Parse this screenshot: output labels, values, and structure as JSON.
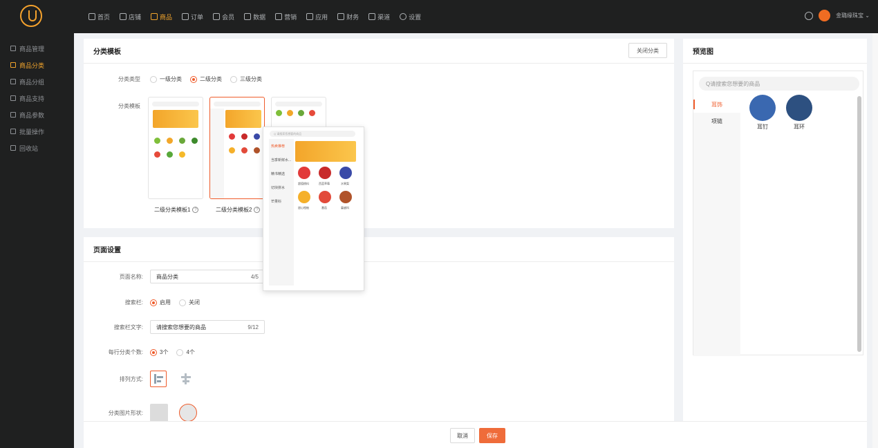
{
  "topbar": {
    "nav": [
      {
        "label": "首页",
        "icon": "home-icon",
        "active": false
      },
      {
        "label": "店铺",
        "icon": "store-icon",
        "active": false
      },
      {
        "label": "商品",
        "icon": "goods-icon",
        "active": true
      },
      {
        "label": "订单",
        "icon": "order-icon",
        "active": false
      },
      {
        "label": "会员",
        "icon": "member-icon",
        "active": false
      },
      {
        "label": "数据",
        "icon": "data-icon",
        "active": false
      },
      {
        "label": "营销",
        "icon": "marketing-icon",
        "active": false
      },
      {
        "label": "应用",
        "icon": "app-icon",
        "active": false
      },
      {
        "label": "财务",
        "icon": "finance-icon",
        "active": false
      },
      {
        "label": "渠道",
        "icon": "channel-icon",
        "active": false
      },
      {
        "label": "设置",
        "icon": "settings-icon",
        "active": false
      }
    ],
    "user_name": "金璐缘珠宝 ⌄"
  },
  "sidebar": {
    "items": [
      {
        "label": "商品管理",
        "active": false
      },
      {
        "label": "商品分类",
        "active": true
      },
      {
        "label": "商品分组",
        "active": false
      },
      {
        "label": "商品支持",
        "active": false
      },
      {
        "label": "商品参数",
        "active": false
      },
      {
        "label": "批量操作",
        "active": false
      },
      {
        "label": "回收站",
        "active": false
      }
    ]
  },
  "template_panel": {
    "title": "分类模板",
    "close_button": "关闭分类",
    "type_label": "分类类型",
    "type_options": [
      "一级分类",
      "二级分类",
      "三级分类"
    ],
    "type_selected": 1,
    "template_label": "分类模板",
    "templates": [
      "二级分类模板1",
      "二级分类模板2"
    ],
    "template_selected": 1
  },
  "page_panel": {
    "title": "页面设置",
    "name_label": "页面名称:",
    "name_value": "商品分类",
    "name_count": "4/5",
    "search_label": "搜索栏:",
    "search_options": [
      "启用",
      "关闭"
    ],
    "search_text_label": "搜索栏文字:",
    "search_text_value": "请搜索您想要的商品",
    "search_text_count": "9/12",
    "per_row_label": "每行分类个数:",
    "per_row_options": [
      "3个",
      "4个"
    ],
    "arrange_label": "排列方式:",
    "shape_label": "分类图片形状:"
  },
  "preview": {
    "title": "预览图",
    "search_placeholder": "Q请搜索您想要的商品",
    "categories": [
      "耳饰",
      "项链"
    ],
    "subcategories": [
      "耳钉",
      "耳环"
    ]
  },
  "popup": {
    "search": "Q 请搜索您想要的商品",
    "categories": [
      "热卖推荐",
      "当季新鲜水...",
      "精书精选",
      "切块拼水",
      "芒果科"
    ],
    "items": [
      "超值桃料",
      "西蓝草莓",
      "水果梨",
      "甜心橙柚",
      "番茄",
      "蔓越科"
    ]
  },
  "footer": {
    "cancel": "取消",
    "save": "保存"
  },
  "colors": {
    "accent": "#ef5b2a",
    "nav_active": "#f1a42c",
    "dark_bg": "#1f2020"
  }
}
